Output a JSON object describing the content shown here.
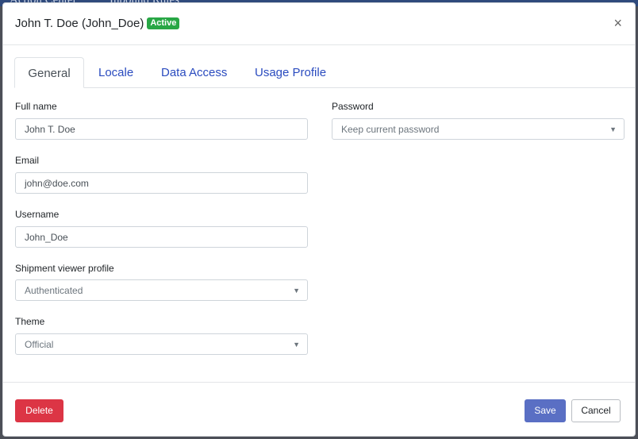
{
  "background": {
    "text_left": "Action Center",
    "text_right": "Inbound Rules"
  },
  "header": {
    "title": "John T. Doe (John_Doe)",
    "status_badge": "Active",
    "close_label": "×"
  },
  "tabs": [
    {
      "label": "General",
      "active": true
    },
    {
      "label": "Locale",
      "active": false
    },
    {
      "label": "Data Access",
      "active": false
    },
    {
      "label": "Usage Profile",
      "active": false
    }
  ],
  "form": {
    "full_name": {
      "label": "Full name",
      "value": "John T. Doe"
    },
    "email": {
      "label": "Email",
      "value": "john@doe.com"
    },
    "username": {
      "label": "Username",
      "value": "John_Doe"
    },
    "shipment_viewer_profile": {
      "label": "Shipment viewer profile",
      "value": "Authenticated"
    },
    "theme": {
      "label": "Theme",
      "value": "Official"
    },
    "password": {
      "label": "Password",
      "value": "Keep current password"
    }
  },
  "footer": {
    "delete_label": "Delete",
    "save_label": "Save",
    "cancel_label": "Cancel"
  },
  "colors": {
    "badge": "#28a745",
    "delete": "#dc3545",
    "save": "#5a6fc4",
    "tab_link": "#2a4bbf"
  },
  "icons": {
    "close": "close-icon",
    "select_caret": "caret-down-icon"
  }
}
